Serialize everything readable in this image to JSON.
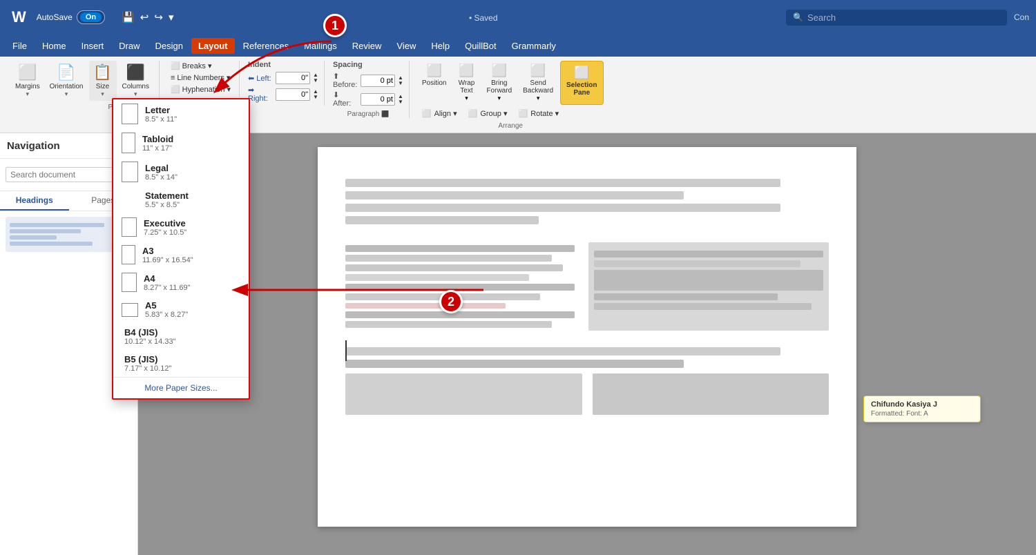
{
  "titlebar": {
    "app": "W",
    "autosave": "AutoSave",
    "toggle": "On",
    "saved": "• Saved",
    "search_placeholder": "Search",
    "connect": "Con"
  },
  "menubar": {
    "items": [
      "File",
      "Home",
      "Insert",
      "Draw",
      "Design",
      "Layout",
      "References",
      "Mailings",
      "Review",
      "View",
      "Help",
      "QuillBot",
      "Grammarly"
    ]
  },
  "ribbon": {
    "groups": {
      "page_setup": {
        "label": "Page Setup",
        "buttons": [
          "Margins",
          "Orientation",
          "Size",
          "Columns"
        ]
      },
      "breaks": {
        "label": "Breaks",
        "line_numbers": "Line Numbers",
        "hyphenation": "Hyphenation ▾"
      },
      "indent": {
        "label": "Indent",
        "left_label": "Left:",
        "left_value": "0\"",
        "right_label": "Right:",
        "right_value": "0\""
      },
      "spacing": {
        "label": "Spacing",
        "before_label": "Before:",
        "before_value": "0 pt",
        "after_label": "After:",
        "after_value": "0 pt"
      },
      "paragraph_label": "Paragraph",
      "arrange": {
        "label": "Arrange",
        "buttons": [
          "Position",
          "Wrap Text",
          "Bring Forward",
          "Send Backward",
          "Selection Pane",
          "Align",
          "Group",
          "Rotate"
        ]
      }
    }
  },
  "navigation": {
    "title": "Navigation",
    "search_placeholder": "Search document",
    "tabs": [
      "Headings",
      "Pages"
    ],
    "active_tab": "Headings"
  },
  "size_dropdown": {
    "items": [
      {
        "name": "Letter",
        "dim": "8.5\" x 11\""
      },
      {
        "name": "Tabloid",
        "dim": "11\" x 17\""
      },
      {
        "name": "Legal",
        "dim": "8.5\" x 14\""
      },
      {
        "name": "Statement",
        "dim": "5.5\" x 8.5\""
      },
      {
        "name": "Executive",
        "dim": "7.25\" x 10.5\""
      },
      {
        "name": "A3",
        "dim": "11.69\" x 16.54\""
      },
      {
        "name": "A4",
        "dim": "8.27\" x 11.69\""
      },
      {
        "name": "A5",
        "dim": "5.83\" x 8.27\""
      },
      {
        "name": "B4 (JIS)",
        "dim": "10.12\" x 14.33\""
      },
      {
        "name": "B5 (JIS)",
        "dim": "7.17\" x 10.12\""
      }
    ],
    "more_label": "More Paper Sizes..."
  },
  "annotations": {
    "badge1": "1",
    "badge2": "2"
  },
  "comment": {
    "name": "Chifundo Kasiya J",
    "text": "Formatted: Font: A"
  }
}
